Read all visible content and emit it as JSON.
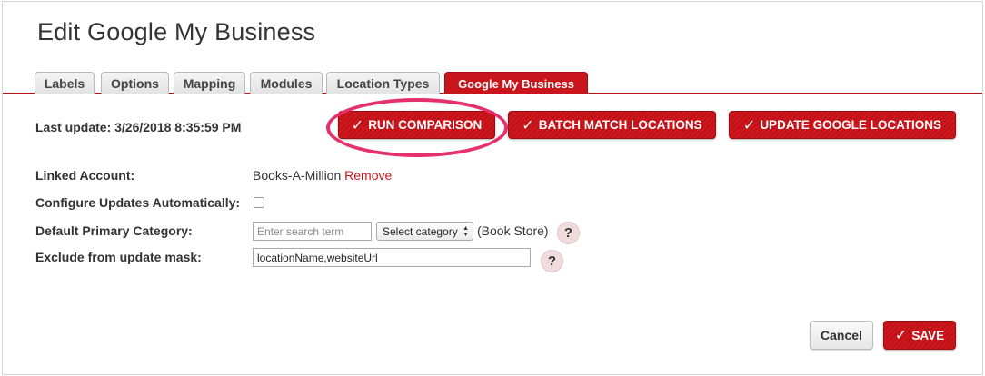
{
  "page": {
    "title": "Edit Google My Business"
  },
  "tabs": [
    {
      "label": "Labels"
    },
    {
      "label": "Options"
    },
    {
      "label": "Mapping"
    },
    {
      "label": "Modules"
    },
    {
      "label": "Location Types"
    },
    {
      "label": "Google My Business",
      "active": true
    }
  ],
  "status": {
    "last_update": "Last update: 3/26/2018 8:35:59 PM"
  },
  "actions": {
    "run_comparison": "RUN COMPARISON",
    "batch_match": "BATCH MATCH LOCATIONS",
    "update_google": "UPDATE GOOGLE LOCATIONS",
    "check_icon": "✓"
  },
  "form": {
    "linked_account_label": "Linked Account:",
    "linked_account_value": "Books-A-Million",
    "remove_link": "Remove",
    "configure_updates_label": "Configure Updates Automatically:",
    "configure_updates_checked": false,
    "primary_category_label": "Default Primary Category:",
    "search_placeholder": "Enter search term",
    "select_category": "Select category",
    "current_category": "(Book Store)",
    "exclude_mask_label": "Exclude from update mask:",
    "exclude_mask_value": "locationName,websiteUrl",
    "help_glyph": "?"
  },
  "footer": {
    "cancel": "Cancel",
    "save": "SAVE"
  },
  "colors": {
    "accent": "#c8161c",
    "highlight": "#e6306d"
  }
}
